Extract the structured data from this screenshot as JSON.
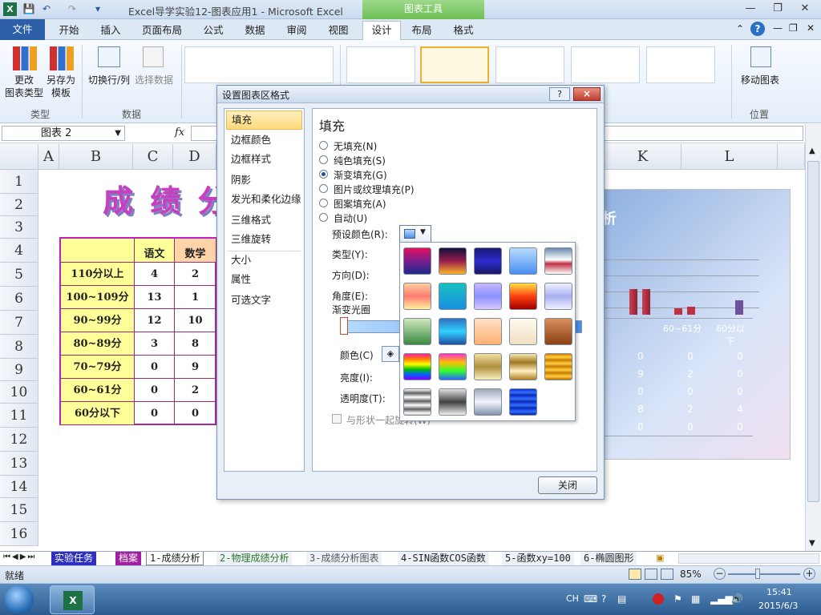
{
  "window": {
    "title": "Excel导学实验12-图表应用1 - Microsoft Excel",
    "context_tab": "图表工具"
  },
  "tabs": [
    "文件",
    "开始",
    "插入",
    "页面布局",
    "公式",
    "数据",
    "审阅",
    "视图",
    "设计",
    "布局",
    "格式"
  ],
  "ribbon": {
    "change_type": "更改\n图表类型",
    "save_template": "另存为\n模板",
    "switch": "切换行/列",
    "select_data": "选择数据",
    "move_chart": "移动图表",
    "groups": {
      "type": "类型",
      "data": "数据",
      "location": "位置"
    }
  },
  "namebox": {
    "value": "图表 2",
    "fx": "fx"
  },
  "columns": [
    "A",
    "B",
    "C",
    "D",
    "K",
    "L"
  ],
  "rows": [
    "1",
    "2",
    "3",
    "4",
    "5",
    "6",
    "7",
    "8",
    "9",
    "10",
    "11",
    "12",
    "13",
    "14",
    "15",
    "16"
  ],
  "sheet_title": "成 绩 分",
  "table": {
    "headers": [
      "语文",
      "数学"
    ],
    "rows": [
      {
        "label": "110分以上",
        "c": "4",
        "d": "2"
      },
      {
        "label": "100~109分",
        "c": "13",
        "d": "1"
      },
      {
        "label": "90~99分",
        "c": "12",
        "d": "10"
      },
      {
        "label": "80~89分",
        "c": "3",
        "d": "8"
      },
      {
        "label": "70~79分",
        "c": "0",
        "d": "9"
      },
      {
        "label": "60~61分",
        "c": "0",
        "d": "2"
      },
      {
        "label": "60分以下",
        "c": "0",
        "d": "0"
      }
    ]
  },
  "chart": {
    "title_fragment": "析",
    "cat_labels": [
      "60~61分",
      "60分以\n下"
    ],
    "vals_k": [
      "0",
      "9",
      "0",
      "8",
      "0"
    ],
    "vals_l": [
      "0",
      "2",
      "0",
      "2",
      "0"
    ],
    "vals_m": [
      "0",
      "0",
      "0",
      "4",
      "0"
    ]
  },
  "dialog": {
    "title": "设置图表区格式",
    "help": "?",
    "close": "×",
    "left_items": [
      "填充",
      "边框颜色",
      "边框样式",
      "阴影",
      "发光和柔化边缘",
      "三维格式",
      "三维旋转",
      "大小",
      "属性",
      "可选文字"
    ],
    "section": "填充",
    "options": [
      "无填充(N)",
      "纯色填充(S)",
      "渐变填充(G)",
      "图片或纹理填充(P)",
      "图案填充(A)",
      "自动(U)"
    ],
    "selected_option": 2,
    "preset_label": "预设颜色(R):",
    "type_label": "类型(Y):",
    "direction_label": "方向(D):",
    "angle_label": "角度(E):",
    "stops_label": "渐变光圈",
    "color_label": "颜色(C)",
    "brightness_label": "亮度(I):",
    "transparency_label": "透明度(T):",
    "rotate_label": "与形状一起旋转(W)",
    "close_button": "关闭"
  },
  "swatches": [
    "linear-gradient(#e0105e,#7b1e8e,#1b2a8a)",
    "linear-gradient(#10103a,#9a1c4c,#f7b32b)",
    "linear-gradient(#1a1a70,#2a2ad0,#1a1a60)",
    "linear-gradient(#b8dcff,#4a8ef0)",
    "linear-gradient(#6a8bb0,#ffffff 45%,#c03040 60%,#ffffff)",
    "linear-gradient(#ffd0a0,#ff7a70,#fff2a0)",
    "linear-gradient(#18c0c0,#1a90e0)",
    "linear-gradient(#c8b8ff,#8a90ff,#d8c8ff)",
    "linear-gradient(#ffe040,#ff4010,#a00000)",
    "linear-gradient(#f0f0ff,#a8b0f0,#f0f0ff)",
    "linear-gradient(#d0e8c0,#3a8a40)",
    "linear-gradient(#3070c0,#30d0ff,#2050a0)",
    "linear-gradient(#ffe0c8,#ffb070)",
    "linear-gradient(#fffaf0,#efe0c0)",
    "linear-gradient(#d89060,#8a4010)",
    "linear-gradient(#ff20a0,#ff8000,#ffff00,#00c000,#0060ff,#8000ff)",
    "linear-gradient(#ff30d0,#ffc000,#30ff30,#3060ff)",
    "linear-gradient(#f0e0a0,#b09040,#f8f0c0)",
    "linear-gradient(#f8e8b0,#a07820,#fff0c0,#b08020)",
    "repeating-linear-gradient(#d08000,#ffd040 4px,#c07000 8px)",
    "repeating-linear-gradient(#ffffff,#606060 5px,#ffffff 10px)",
    "linear-gradient(#e0e0e0,#404040,#f0f0f0)",
    "linear-gradient(#a0a8b8,#f0f4ff,#8090a8)",
    "repeating-linear-gradient(#1030d0,#3070ff 4px,#0820a0 8px)"
  ],
  "sheets": [
    "实验任务",
    "档案",
    "1-成绩分析",
    "2-物理成绩分析",
    "3-成绩分析图表",
    "4-SIN函数COS函数",
    "5-函数xy=100",
    "6-椭圆图形"
  ],
  "status": {
    "ready": "就绪",
    "zoom": "85%"
  },
  "tray": {
    "lang": "CH",
    "time": "15:41",
    "date": "2015/6/3"
  }
}
